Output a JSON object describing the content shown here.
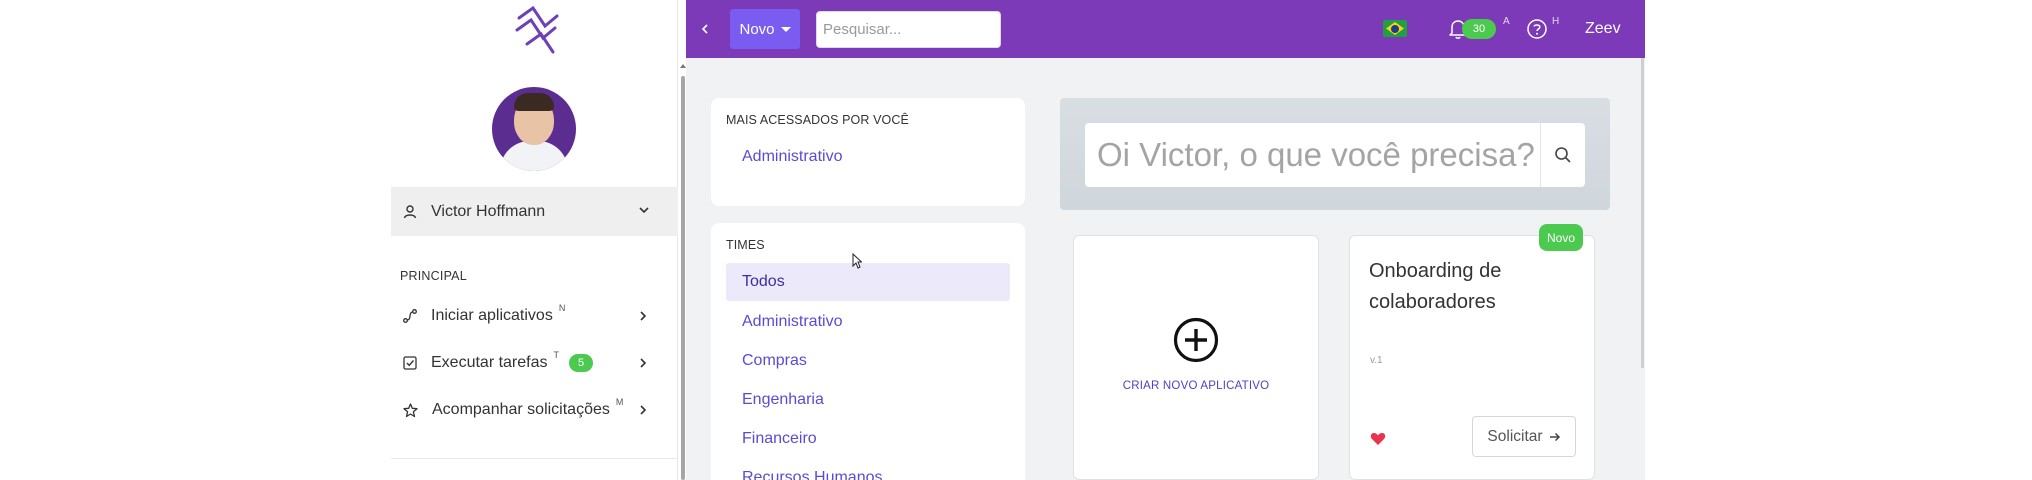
{
  "sidebar": {
    "user_name": "Victor Hoffmann",
    "section_label": "PRINCIPAL",
    "items": [
      {
        "label": "Iniciar aplicativos",
        "shortcut": "N",
        "icon": "route-icon"
      },
      {
        "label": "Executar tarefas",
        "shortcut": "T",
        "badge": "5",
        "icon": "checkbox-icon"
      },
      {
        "label": "Acompanhar solicitações",
        "shortcut": "M",
        "icon": "star-icon"
      }
    ]
  },
  "topbar": {
    "new_button": "Novo",
    "search_placeholder": "Pesquisar...",
    "notifications_count": "30",
    "notifications_shortcut": "A",
    "help_shortcut": "H",
    "username": "Zeev"
  },
  "most_accessed": {
    "title": "MAIS ACESSADOS POR VOCÊ",
    "items": [
      "Administrativo"
    ]
  },
  "teams": {
    "title": "TIMES",
    "items": [
      "Todos",
      "Administrativo",
      "Compras",
      "Engenharia",
      "Financeiro",
      "Recursos Humanos"
    ]
  },
  "hero": {
    "placeholder": "Oi Victor, o que você precisa?"
  },
  "create_app": {
    "label": "CRIAR NOVO APLICATIVO"
  },
  "app_card": {
    "badge": "Novo",
    "title": "Onboarding de colaboradores",
    "version": "v.1",
    "request_button": "Solicitar"
  },
  "colors": {
    "topbar": "#7c3ab8",
    "accent_button": "#7a5cf0",
    "link": "#5b4bd4",
    "success": "#4cc94f"
  }
}
